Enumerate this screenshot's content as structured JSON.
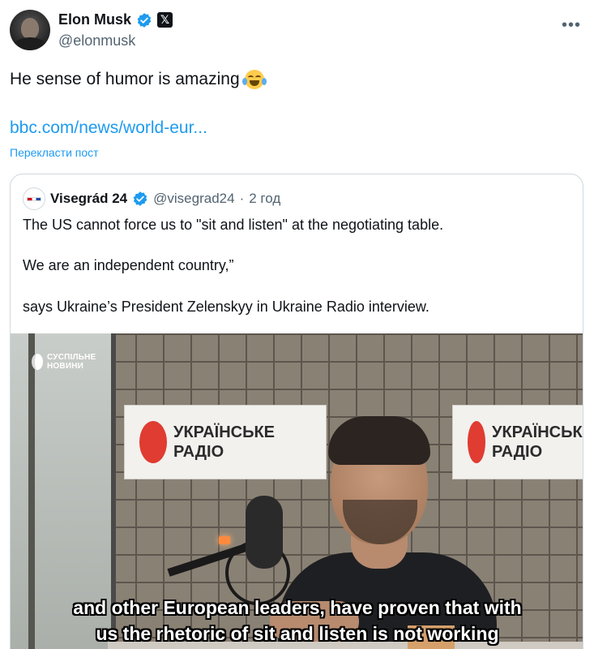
{
  "author": {
    "name": "Elon Musk",
    "handle": "@elonmusk",
    "verified_icon": "verified-badge-icon",
    "affiliation_icon": "x-logo-icon",
    "badge_color": "#1d9bf0"
  },
  "tweet": {
    "text": "He sense of humor is amazing",
    "emoji": "face-with-tears-of-joy",
    "link_text": "bbc.com/news/world-eur...",
    "translate_label": "Перекласти пост"
  },
  "quote": {
    "name": "Visegrád 24",
    "handle": "@visegrad24",
    "separator": "·",
    "time": "2 год",
    "lines": [
      "The US cannot force us to \"sit and listen\" at the negotiating table.",
      "We are an independent country,”",
      "says Ukraine’s President Zelenskyy in Ukraine Radio interview."
    ],
    "media": {
      "watermark_line1": "СУСПІЛЬНЕ",
      "watermark_line2": "НОВИНИ",
      "sign_text": "УКРАЇНСЬКЕ\nРАДІО",
      "sign_text_2": "УКРАЇНСЬКЕ\nРАДІО",
      "subtitle_line1": "and other European leaders, have proven that with",
      "subtitle_line2": "us the rhetoric of sit and listen is not working"
    }
  },
  "colors": {
    "link": "#1d9bf0",
    "secondary_text": "#536471",
    "primary_text": "#0f1419",
    "border": "#cfd9de"
  }
}
